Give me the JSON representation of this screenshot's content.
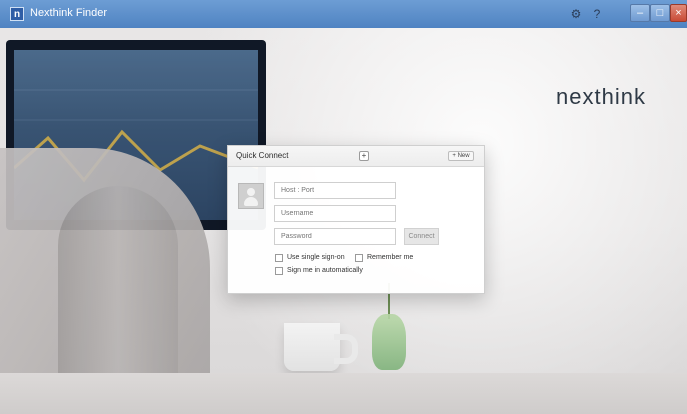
{
  "window": {
    "title": "Nexthink Finder",
    "app_icon_letter": "n"
  },
  "titlebar_icons": [
    {
      "name": "settings-icon",
      "glyph": "⚙"
    },
    {
      "name": "help-icon",
      "glyph": "?"
    }
  ],
  "window_controls": {
    "minimize": "–",
    "maximize": "□",
    "close": "×"
  },
  "logo": {
    "text": "nexthink"
  },
  "quick_connect": {
    "title": "Quick Connect",
    "add_label": "+",
    "new_label": "+ New",
    "host_placeholder": "Host : Port",
    "username_placeholder": "Username",
    "password_placeholder": "Password",
    "connect_label": "Connect",
    "options": {
      "single_sign_on": "Use single sign-on",
      "remember_me": "Remember me",
      "auto_sign_in": "Sign me in automatically"
    }
  }
}
